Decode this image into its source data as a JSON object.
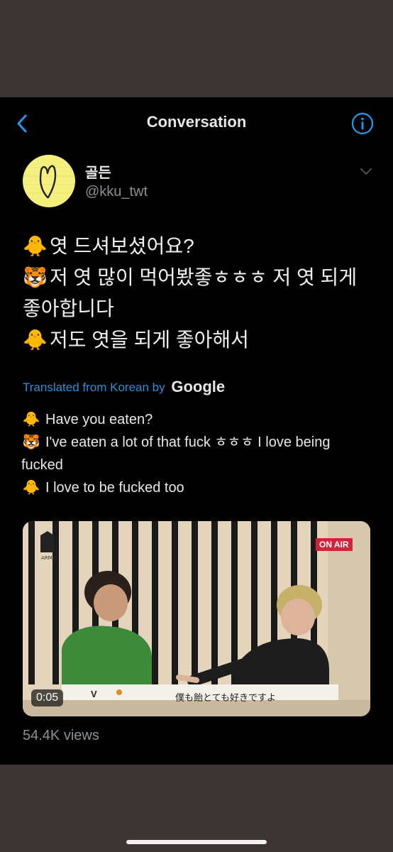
{
  "nav": {
    "title": "Conversation",
    "back_icon": "chevron-left-icon",
    "info_icon": "info-circle-icon",
    "accent": "#1d9bf0"
  },
  "author": {
    "display_name": "골든",
    "handle": "@kku_twt",
    "avatar_color": "#f4f07e"
  },
  "tweet": {
    "lines": [
      {
        "emoji": "🐥",
        "text": "엿 드셔보셨어요?"
      },
      {
        "emoji": "🐯",
        "text": "저 엿 많이 먹어봤좋ㅎㅎㅎ 저 엿 되게"
      },
      {
        "emoji": "",
        "text": "좋아합니다"
      },
      {
        "emoji": "🐥",
        "text": "저도 엿을 되게 좋아해서"
      }
    ]
  },
  "translation": {
    "label": "Translated from Korean by",
    "provider": "Google",
    "lines": [
      {
        "emoji": "🐥",
        "text": "Have you eaten?"
      },
      {
        "emoji": "🐯",
        "text": "I've eaten a lot of that fuck ㅎㅎㅎ I love being"
      },
      {
        "emoji": "",
        "text": "fucked"
      },
      {
        "emoji": "🐥",
        "text": "I love to be fucked too"
      }
    ]
  },
  "media": {
    "duration": "0:05",
    "badge": "ON AIR",
    "subtitle_name": "V",
    "subtitle": "僕も飴とても好きですよ",
    "logo_text": "ARMY"
  },
  "stats": {
    "views": "54.4K views"
  }
}
